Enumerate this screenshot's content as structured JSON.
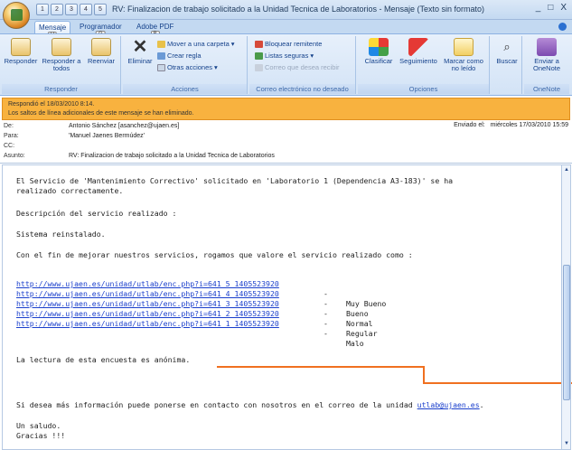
{
  "window": {
    "title": "RV: Finalizacion de trabajo solicitado a la Unidad Tecnica de Laboratorios  -  Mensaje (Texto sin formato)",
    "controls": [
      "_",
      "□",
      "X"
    ]
  },
  "qat_keys": [
    "1",
    "2",
    "3",
    "4",
    "5"
  ],
  "tabs": [
    {
      "label": "Mensaje",
      "key": "H",
      "active": true
    },
    {
      "label": "Programador",
      "key": "G",
      "active": false
    },
    {
      "label": "Adobe PDF",
      "key": "B",
      "active": false
    }
  ],
  "ribbon": {
    "responder": {
      "label": "Responder",
      "buttons": [
        "Responder",
        "Responder a todos",
        "Reenviar"
      ]
    },
    "acciones": {
      "label": "Acciones",
      "delete": "Eliminar",
      "move": "Mover a una carpeta",
      "rule": "Crear regla",
      "other": "Otras acciones"
    },
    "correo": {
      "label": "Correo electrónico no deseado",
      "block": "Bloquear remitente",
      "safe": "Listas seguras",
      "notjunk": "Correo que desea recibir"
    },
    "opciones": {
      "label": "Opciones",
      "classify": "Clasificar",
      "followup": "Seguimiento",
      "unread": "Marcar como no leído"
    },
    "buscar": {
      "label": "Buscar"
    },
    "onenote": {
      "label": "OneNote",
      "send": "Enviar a OneNote"
    }
  },
  "infobar": {
    "line1": "Respondió el 18/03/2010 8:14.",
    "line2": "Los saltos de línea adicionales de este mensaje se han eliminado."
  },
  "headers": {
    "de_label": "De:",
    "de_value": "Antonio Sánchez [asanchez@ujaen.es]",
    "para_label": "Para:",
    "para_value": "'Manuel Jaenes Bermúdez'",
    "cc_label": "CC:",
    "cc_value": "",
    "asunto_label": "Asunto:",
    "asunto_value": "RV: Finalizacion de trabajo solicitado a la Unidad Tecnica de Laboratorios",
    "sent_label": "Enviado el:",
    "sent_value": "miércoles 17/03/2010 15:59"
  },
  "body": {
    "p1_line1": "El Servicio de 'Mantenimiento Correctivo' solicitado en 'Laboratorio 1 (Dependencia A3-183)' se ha",
    "p1_line2": "realizado correctamente.",
    "desc": "Descripción del servicio realizado :",
    "sistema": "Sistema reinstalado.",
    "ask": "Con el fin de mejorar nuestros servicios, rogamos que valore el servicio realizado como :",
    "links": [
      {
        "url": "http://www.ujaen.es/unidad/utlab/enc.php?i=641 5 1405523920",
        "dash": "-",
        "rating": "Muy Bueno"
      },
      {
        "url": "http://www.ujaen.es/unidad/utlab/enc.php?i=641 4 1405523920",
        "dash": "-",
        "rating": "Bueno"
      },
      {
        "url": "http://www.ujaen.es/unidad/utlab/enc.php?i=641 3 1405523920",
        "dash": "-",
        "rating": "Normal"
      },
      {
        "url": "http://www.ujaen.es/unidad/utlab/enc.php?i=641 2 1405523920",
        "dash": "-",
        "rating": "Regular"
      },
      {
        "url": "http://www.ujaen.es/unidad/utlab/enc.php?i=641 1 1405523920",
        "dash": "-",
        "rating": "Malo"
      }
    ],
    "anon": "La lectura de esta encuesta es anónima.",
    "contact_prefix": "Si desea más información puede ponerse en contacto con nosotros en el correo de la unidad ",
    "contact_email": "utlab@ujaen.es",
    "contact_suffix": ".",
    "saludo": "Un saludo.",
    "gracias": "Gracias !!!"
  },
  "colors": {
    "infobar": "#f8b23f",
    "annotation": "#f07020",
    "link": "#1a3fcc"
  }
}
